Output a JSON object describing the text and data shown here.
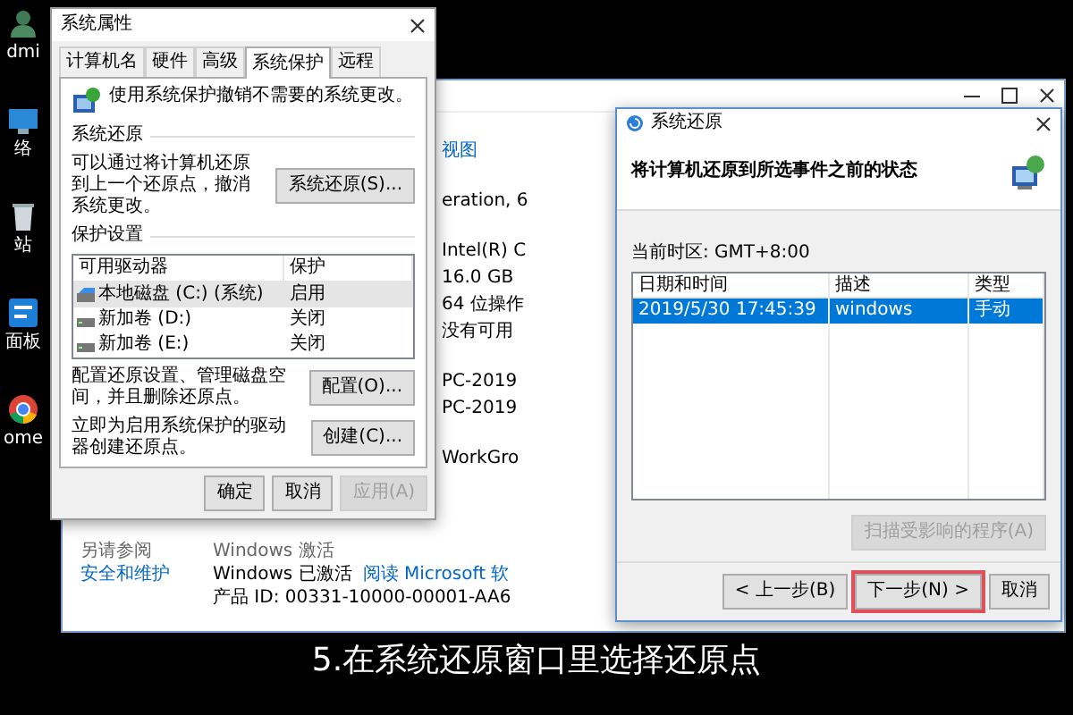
{
  "desktop_icons": [
    {
      "label": "dmi"
    },
    {
      "label": "络"
    },
    {
      "label": "站"
    },
    {
      "label": "面板"
    },
    {
      "label": "ome"
    }
  ],
  "background_window": {
    "link": "视图",
    "spec_groups": [
      [
        "eration, 6"
      ],
      [
        "Intel(R) C",
        "16.0 GB",
        "64 位操作",
        "没有可用"
      ],
      [
        "PC-2019",
        "PC-2019"
      ],
      [
        "WorkGro"
      ]
    ],
    "see_also": "另请参阅",
    "see_also_link": "安全和维护",
    "activation_heading": "Windows 激活",
    "activation_status": "Windows 已激活",
    "activation_link": "阅读 Microsoft 软",
    "product_id": "产品 ID: 00331-10000-00001-AA6"
  },
  "system_properties": {
    "title": "系统属性",
    "tabs": [
      {
        "label": "计算机名",
        "selected": false
      },
      {
        "label": "硬件",
        "selected": false
      },
      {
        "label": "高级",
        "selected": false
      },
      {
        "label": "系统保护",
        "selected": true
      },
      {
        "label": "远程",
        "selected": false
      }
    ],
    "intro": "使用系统保护撤销不需要的系统更改。",
    "restore_section": "系统还原",
    "restore_text": "可以通过将计算机还原到上一个还原点，撤消系统更改。",
    "restore_button": "系统还原(S)...",
    "protection_section": "保护设置",
    "drive_columns": [
      "可用驱动器",
      "保护"
    ],
    "drives": [
      {
        "name": "本地磁盘 (C:) (系统)",
        "protection": "启用",
        "kind": "system",
        "selected": true
      },
      {
        "name": "新加卷 (D:)",
        "protection": "关闭",
        "kind": "volume",
        "selected": false
      },
      {
        "name": "新加卷 (E:)",
        "protection": "关闭",
        "kind": "volume",
        "selected": false
      }
    ],
    "configure_text": "配置还原设置、管理磁盘空间，并且删除还原点。",
    "configure_button": "配置(O)...",
    "create_text": "立即为启用系统保护的驱动器创建还原点。",
    "create_button": "创建(C)...",
    "buttons": [
      {
        "label": "确定",
        "disabled": false
      },
      {
        "label": "取消",
        "disabled": false
      },
      {
        "label": "应用(A)",
        "disabled": true
      }
    ]
  },
  "system_restore": {
    "title": "系统还原",
    "heading": "将计算机还原到所选事件之前的状态",
    "timezone": "当前时区: GMT+8:00",
    "columns": [
      "日期和时间",
      "描述",
      "类型"
    ],
    "points": [
      {
        "date": "2019/5/30 17:45:39",
        "description": "windows",
        "type": "手动",
        "selected": true
      }
    ],
    "scan_button": {
      "label": "扫描受影响的程序(A)",
      "disabled": true
    },
    "buttons": [
      {
        "label": "< 上一步(B)",
        "disabled": false,
        "highlighted": false
      },
      {
        "label": "下一步(N) >",
        "disabled": false,
        "highlighted": true
      },
      {
        "label": "取消",
        "disabled": false,
        "highlighted": false
      }
    ]
  },
  "caption": "5.在系统还原窗口里选择还原点"
}
